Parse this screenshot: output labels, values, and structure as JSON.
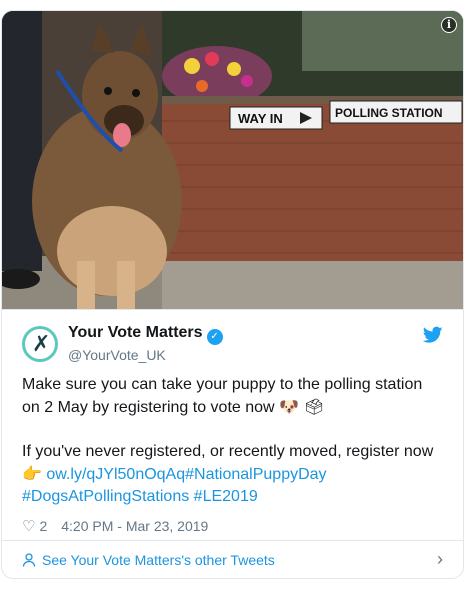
{
  "media": {
    "sign_way_in": "WAY IN",
    "sign_polling": "POLLING STATION",
    "info_icon": "info-icon"
  },
  "tweet": {
    "display_name": "Your Vote Matters",
    "handle": "@YourVote_UK",
    "line1": "Make sure you can take your puppy to the polling station on 2 May by registering to vote now",
    "line1_emoji": "🐶 🗳",
    "line2": "If you've never registered, or recently moved, register now",
    "pointer_emoji": "👉",
    "link": "ow.ly/qJYl50nOqAq",
    "hashtag1": "#NationalPuppyDay",
    "hashtag2": "#DogsAtPollingStations",
    "hashtag3": "#LE2019",
    "like_count": "2",
    "timestamp": "4:20 PM - Mar 23, 2019"
  },
  "footer": {
    "label": "See Your Vote Matters's other Tweets"
  },
  "colors": {
    "link": "#1b95e0",
    "verified": "#1da1f2",
    "muted": "#657786"
  }
}
